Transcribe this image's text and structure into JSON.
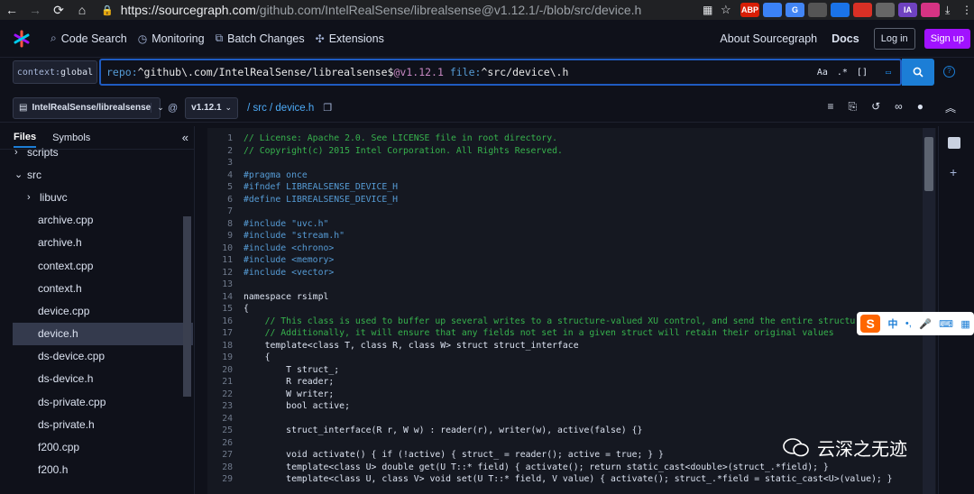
{
  "browser": {
    "url_host": "https://sourcegraph.com",
    "url_path": "/github.com/IntelRealSense/librealsense@v1.12.1/-/blob/src/device.h",
    "extensions": [
      {
        "label": "ABP",
        "color": "#d81e06"
      },
      {
        "label": "",
        "color": "#3b82f6"
      },
      {
        "label": "G",
        "color": "#4285f4"
      },
      {
        "label": "",
        "color": "#555"
      },
      {
        "label": "",
        "color": "#1a73e8"
      },
      {
        "label": "",
        "color": "#d93025"
      },
      {
        "label": "",
        "color": "#666"
      },
      {
        "label": "IA",
        "color": "#6f42c1"
      },
      {
        "label": "",
        "color": "#d63384"
      }
    ]
  },
  "topnav": {
    "items": [
      {
        "label": "Code Search",
        "icon": "search-icon"
      },
      {
        "label": "Monitoring",
        "icon": "monitor-icon"
      },
      {
        "label": "Batch Changes",
        "icon": "batch-changes-icon"
      },
      {
        "label": "Extensions",
        "icon": "puzzle-icon"
      }
    ],
    "about": "About Sourcegraph",
    "docs": "Docs",
    "login": "Log in",
    "signup": "Sign up"
  },
  "search": {
    "context_key": "context:",
    "context_value": "global",
    "q_repo_key": "repo:",
    "q_repo_val": "^github\\.com/IntelRealSense/librealsense$",
    "q_rev": "@v1.12.1",
    "q_file_key": "file:",
    "q_file_val": "^src/device\\.h",
    "case_toggle": "Aa",
    "regex_toggle": ".*",
    "structural_toggle": "[]"
  },
  "breadcrumb": {
    "repo": "IntelRealSense/librealsense",
    "at": "@",
    "revision": "v1.12.1",
    "path": "/ src / device.h"
  },
  "sidebar": {
    "tabs": [
      "Files",
      "Symbols"
    ],
    "items": [
      {
        "label": "scripts",
        "indent": 1,
        "arrow": "›"
      },
      {
        "label": "src",
        "indent": 1,
        "arrow": "⌄"
      },
      {
        "label": "libuvc",
        "indent": 2,
        "arrow": "›"
      },
      {
        "label": "archive.cpp",
        "indent": 3,
        "arrow": ""
      },
      {
        "label": "archive.h",
        "indent": 3,
        "arrow": ""
      },
      {
        "label": "context.cpp",
        "indent": 3,
        "arrow": ""
      },
      {
        "label": "context.h",
        "indent": 3,
        "arrow": ""
      },
      {
        "label": "device.cpp",
        "indent": 3,
        "arrow": ""
      },
      {
        "label": "device.h",
        "indent": 3,
        "arrow": "",
        "selected": true
      },
      {
        "label": "ds-device.cpp",
        "indent": 3,
        "arrow": ""
      },
      {
        "label": "ds-device.h",
        "indent": 3,
        "arrow": ""
      },
      {
        "label": "ds-private.cpp",
        "indent": 3,
        "arrow": ""
      },
      {
        "label": "ds-private.h",
        "indent": 3,
        "arrow": ""
      },
      {
        "label": "f200.cpp",
        "indent": 3,
        "arrow": ""
      },
      {
        "label": "f200.h",
        "indent": 3,
        "arrow": ""
      }
    ]
  },
  "code": {
    "lines": [
      {
        "n": "1",
        "t": "// License: Apache 2.0. See LICENSE file in root directory.",
        "c": "c"
      },
      {
        "n": "2",
        "t": "// Copyright(c) 2015 Intel Corporation. All Rights Reserved.",
        "c": "c"
      },
      {
        "n": "3",
        "t": "",
        "c": ""
      },
      {
        "n": "4",
        "t": "#pragma once",
        "c": "pp"
      },
      {
        "n": "5",
        "t": "#ifndef LIBREALSENSE_DEVICE_H",
        "c": "pp"
      },
      {
        "n": "6",
        "t": "#define LIBREALSENSE_DEVICE_H",
        "c": "pp"
      },
      {
        "n": "7",
        "t": "",
        "c": ""
      },
      {
        "n": "8",
        "t": "#include \"uvc.h\"",
        "c": "pp"
      },
      {
        "n": "9",
        "t": "#include \"stream.h\"",
        "c": "pp"
      },
      {
        "n": "10",
        "t": "#include <chrono>",
        "c": "pp"
      },
      {
        "n": "11",
        "t": "#include <memory>",
        "c": "pp"
      },
      {
        "n": "12",
        "t": "#include <vector>",
        "c": "pp"
      },
      {
        "n": "13",
        "t": "",
        "c": ""
      },
      {
        "n": "14",
        "t": "namespace rsimpl",
        "c": "s"
      },
      {
        "n": "15",
        "t": "{",
        "c": "s"
      },
      {
        "n": "16",
        "t": "    // This class is used to buffer up several writes to a structure-valued XU control, and send the entire structure all",
        "c": "c"
      },
      {
        "n": "17",
        "t": "    // Additionally, it will ensure that any fields not set in a given struct will retain their original values",
        "c": "c"
      },
      {
        "n": "18",
        "t": "    template<class T, class R, class W> struct struct_interface",
        "c": "s"
      },
      {
        "n": "19",
        "t": "    {",
        "c": "s"
      },
      {
        "n": "20",
        "t": "        T struct_;",
        "c": "s"
      },
      {
        "n": "21",
        "t": "        R reader;",
        "c": "s"
      },
      {
        "n": "22",
        "t": "        W writer;",
        "c": "s"
      },
      {
        "n": "23",
        "t": "        bool active;",
        "c": "s"
      },
      {
        "n": "24",
        "t": "",
        "c": ""
      },
      {
        "n": "25",
        "t": "        struct_interface(R r, W w) : reader(r), writer(w), active(false) {}",
        "c": "s"
      },
      {
        "n": "26",
        "t": "",
        "c": ""
      },
      {
        "n": "27",
        "t": "        void activate() { if (!active) { struct_ = reader(); active = true; } }",
        "c": "s"
      },
      {
        "n": "28",
        "t": "        template<class U> double get(U T::* field) { activate(); return static_cast<double>(struct_.*field); }",
        "c": "s"
      },
      {
        "n": "29",
        "t": "        template<class U, class V> void set(U T::* field, V value) { activate(); struct_.*field = static_cast<U>(value); }",
        "c": "s"
      }
    ]
  },
  "ime": {
    "lang": "中",
    "items": [
      "•,",
      "🎤",
      "⌨",
      "▦"
    ]
  },
  "watermark": "云深之无迹"
}
